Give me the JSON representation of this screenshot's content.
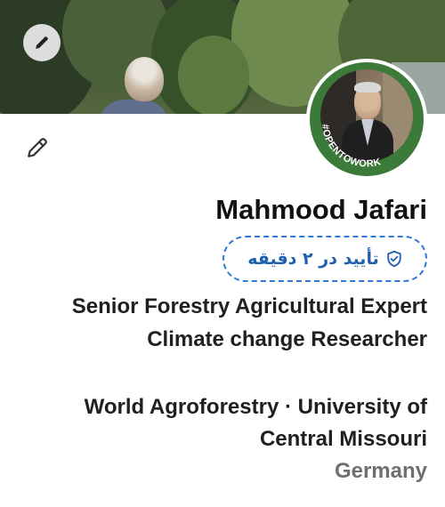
{
  "profile": {
    "name": "Mahmood Jafari",
    "verify_label": "تأیید در ۲ دقیقه",
    "headline": "Senior Forestry Agricultural Expert Climate change Researcher",
    "company": "World Agroforestry · University of Central Missouri",
    "location": "Germany",
    "open_to_work_label": "#OPENTOWORK"
  },
  "icons": {
    "cover_edit": "pencil-icon",
    "profile_edit": "pencil-icon",
    "verify": "shield-check-icon"
  },
  "colors": {
    "verify_accent": "#2f7ad8",
    "open_to_work_ring": "#3c7a3a",
    "location_text": "#6f6f6f"
  }
}
